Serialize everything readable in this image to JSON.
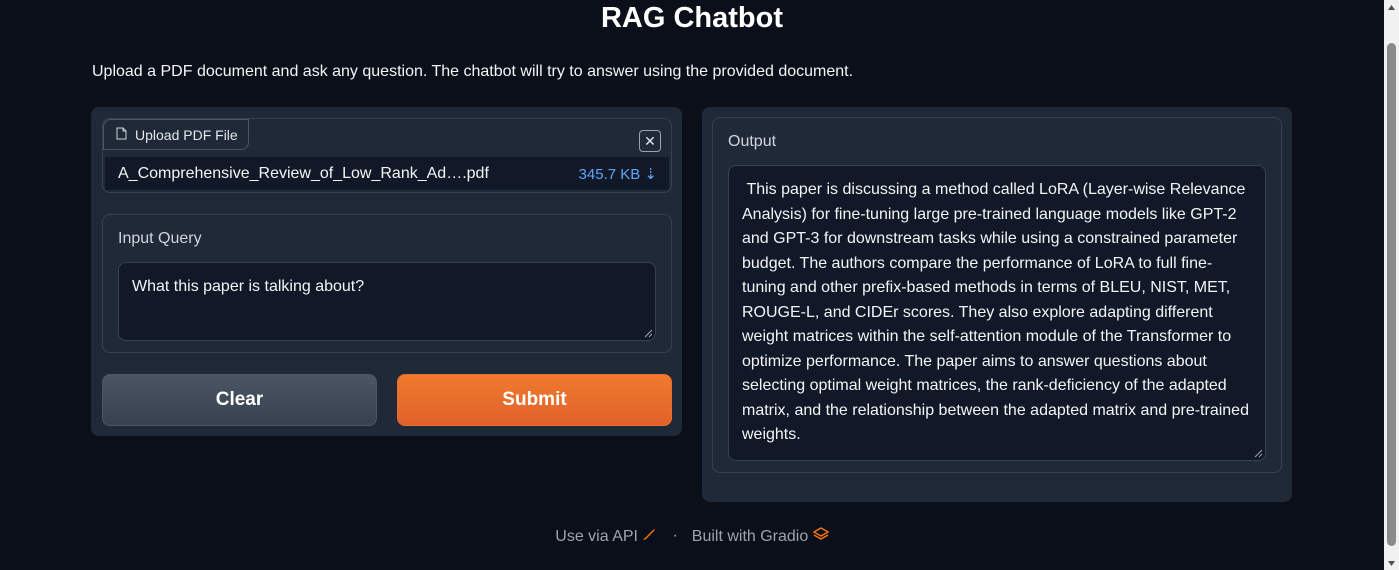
{
  "header": {
    "title": "RAG Chatbot",
    "description": "Upload a PDF document and ask any question. The chatbot will try to answer using the provided document."
  },
  "file_upload": {
    "label": "Upload PDF File",
    "file_name": "A_Comprehensive_Review_of_Low_Rank_Ad….pdf",
    "file_size": "345.7 KB ⇣",
    "close_icon": "close-icon",
    "label_icon": "file-icon"
  },
  "query": {
    "label": "Input Query",
    "value": "What this paper is talking about?"
  },
  "buttons": {
    "clear_label": "Clear",
    "submit_label": "Submit"
  },
  "output": {
    "label": "Output",
    "text": " This paper is discussing a method called LoRA (Layer-wise Relevance Analysis) for fine-tuning large pre-trained language models like GPT-2 and GPT-3 for downstream tasks while using a constrained parameter budget. The authors compare the performance of LoRA to full fine-tuning and other prefix-based methods in terms of BLEU, NIST, MET, ROUGE-L, and CIDEr scores. They also explore adapting different weight matrices within the self-attention module of the Transformer to optimize performance. The paper aims to answer questions about selecting optimal weight matrices, the rank-deficiency of the adapted matrix, and the relationship between the adapted matrix and pre-trained weights."
  },
  "footer": {
    "api_label": "Use via API",
    "separator": "·",
    "built_label": "Built with Gradio"
  },
  "colors": {
    "background": "#0b0f19",
    "panel": "#1f2937",
    "accent": "#ea6c2c",
    "link": "#60a5fa"
  }
}
